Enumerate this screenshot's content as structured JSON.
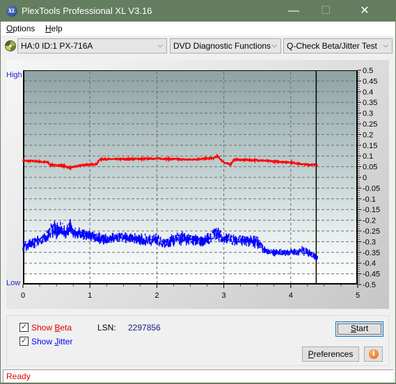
{
  "window": {
    "title": "PlexTools Professional XL V3.16",
    "app_icon_text": "XL",
    "minimize_glyph": "—",
    "maximize_glyph": "☐",
    "close_glyph": "✕"
  },
  "menu": {
    "items": [
      {
        "label": "Options",
        "accel": "O",
        "rest": "ptions"
      },
      {
        "label": "Help",
        "accel": "H",
        "rest": "elp"
      }
    ]
  },
  "toolbar": {
    "drive_select": "HA:0 ID:1  PX-716A",
    "function_select": "DVD Diagnostic Functions",
    "test_select": "Q-Check Beta/Jitter Test",
    "chevron": "⌵"
  },
  "chart_labels": {
    "high": "High",
    "low": "Low"
  },
  "chart_data": {
    "type": "line",
    "title": "",
    "xlabel": "",
    "ylabel": "",
    "xlim": [
      0,
      5
    ],
    "ylim": [
      -0.5,
      0.5
    ],
    "x_ticks": [
      "0",
      "1",
      "2",
      "3",
      "4",
      "5"
    ],
    "y_ticks": [
      "0.5",
      "0.45",
      "0.4",
      "0.35",
      "0.3",
      "0.25",
      "0.2",
      "0.15",
      "0.1",
      "0.05",
      "0",
      "-0.05",
      "-0.1",
      "-0.15",
      "-0.2",
      "-0.25",
      "-0.3",
      "-0.35",
      "-0.4",
      "-0.45",
      "-0.5"
    ],
    "grid": true,
    "cursor_x": 4.38,
    "series": [
      {
        "name": "Beta",
        "color": "#ff0000",
        "x": [
          0.0,
          0.2,
          0.38,
          0.4,
          0.6,
          0.7,
          0.9,
          1.1,
          1.15,
          1.5,
          2.0,
          2.5,
          2.85,
          2.9,
          3.0,
          3.1,
          3.15,
          3.5,
          4.0,
          4.2,
          4.4
        ],
        "y": [
          0.078,
          0.075,
          0.07,
          0.058,
          0.055,
          0.045,
          0.058,
          0.062,
          0.085,
          0.085,
          0.088,
          0.083,
          0.09,
          0.1,
          0.07,
          0.06,
          0.083,
          0.08,
          0.07,
          0.06,
          0.058
        ]
      },
      {
        "name": "Jitter",
        "color": "#0000ff",
        "x": [
          0.0,
          0.1,
          0.2,
          0.3,
          0.4,
          0.45,
          0.5,
          0.55,
          0.6,
          0.65,
          0.7,
          0.75,
          0.8,
          1.0,
          1.2,
          1.5,
          1.8,
          2.0,
          2.1,
          2.3,
          2.5,
          2.7,
          2.85,
          2.9,
          3.0,
          3.2,
          3.4,
          3.5,
          3.6,
          3.7,
          3.9,
          4.1,
          4.2,
          4.3,
          4.4
        ],
        "y_center": [
          -0.32,
          -0.31,
          -0.3,
          -0.29,
          -0.26,
          -0.24,
          -0.25,
          -0.24,
          -0.25,
          -0.26,
          -0.23,
          -0.26,
          -0.26,
          -0.27,
          -0.29,
          -0.28,
          -0.29,
          -0.29,
          -0.31,
          -0.28,
          -0.29,
          -0.3,
          -0.27,
          -0.26,
          -0.29,
          -0.29,
          -0.3,
          -0.3,
          -0.34,
          -0.35,
          -0.35,
          -0.35,
          -0.34,
          -0.36,
          -0.38
        ],
        "y_spread": [
          0.03,
          0.03,
          0.03,
          0.03,
          0.04,
          0.05,
          0.04,
          0.05,
          0.04,
          0.03,
          0.05,
          0.03,
          0.03,
          0.03,
          0.03,
          0.03,
          0.03,
          0.03,
          0.03,
          0.04,
          0.03,
          0.03,
          0.04,
          0.04,
          0.03,
          0.03,
          0.03,
          0.04,
          0.02,
          0.02,
          0.02,
          0.02,
          0.03,
          0.02,
          0.02
        ]
      }
    ]
  },
  "controls": {
    "show_beta": {
      "checked": true,
      "label_pre": "Show ",
      "accel": "B",
      "rest": "eta",
      "color": "#e00000"
    },
    "show_jitter": {
      "checked": true,
      "label_pre": "Show ",
      "accel": "J",
      "rest": "itter",
      "color": "#0000ff"
    },
    "check_glyph": "✓",
    "lsn_label": "LSN:",
    "lsn_value": "2297856",
    "start": {
      "accel": "S",
      "rest": "tart"
    },
    "preferences": {
      "accel": "P",
      "rest": "references"
    },
    "info_glyph": "i"
  },
  "status": {
    "text": "Ready"
  }
}
